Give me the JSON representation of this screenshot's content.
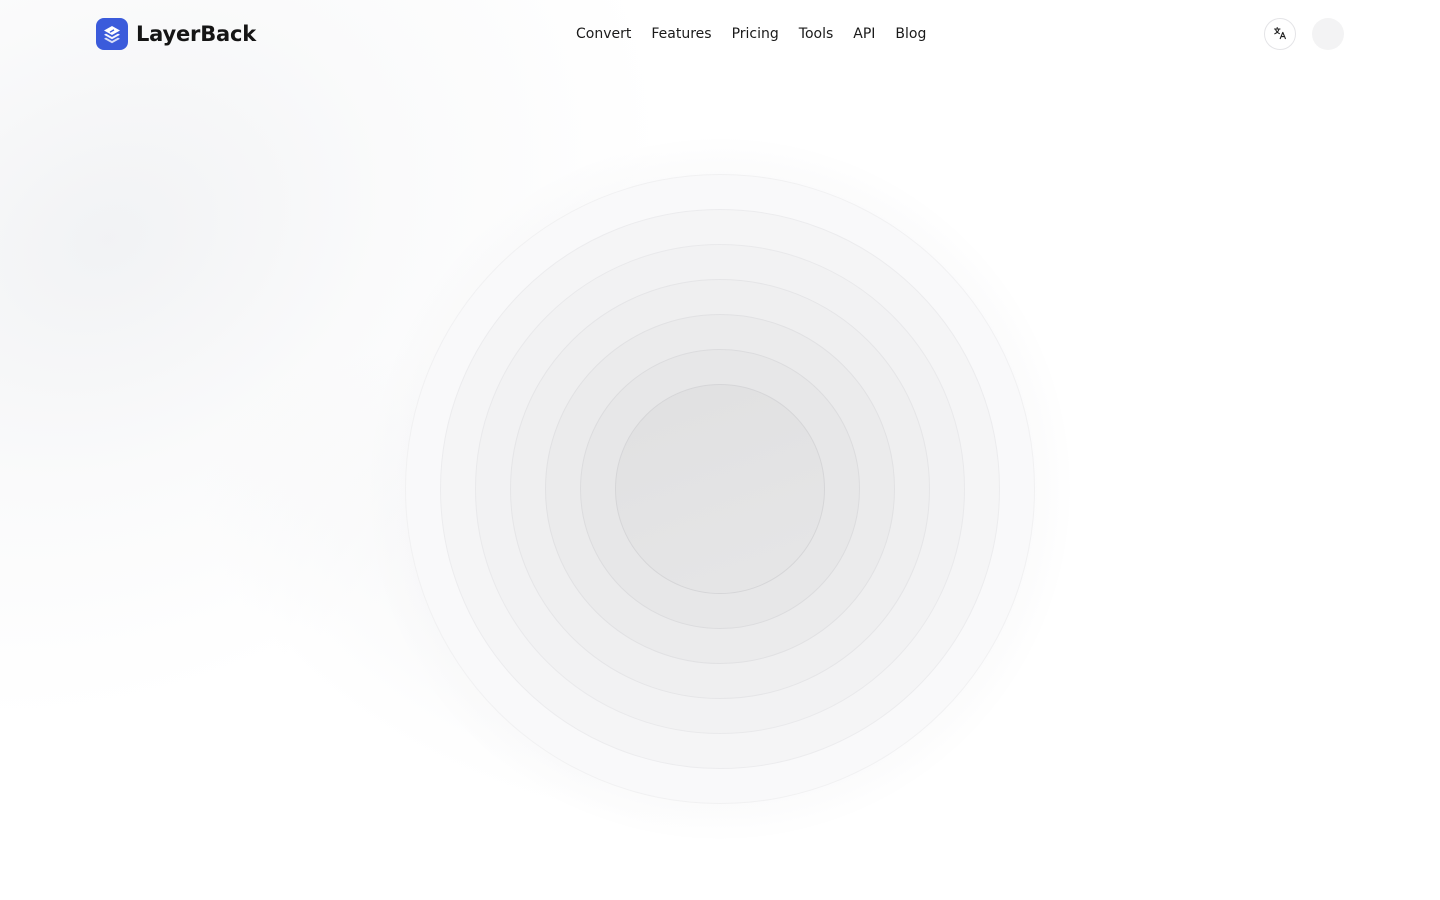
{
  "brand": {
    "name": "LayerBack",
    "logo_color": "#3b5bdb",
    "logo_icon": "layers-icon"
  },
  "nav": {
    "items": [
      {
        "label": "Convert"
      },
      {
        "label": "Features"
      },
      {
        "label": "Pricing"
      },
      {
        "label": "Tools"
      },
      {
        "label": "API"
      },
      {
        "label": "Blog"
      }
    ]
  },
  "header_actions": {
    "language_icon": "translate-icon",
    "avatar": "user-avatar-placeholder"
  },
  "main": {
    "state": "loading",
    "indicator_icon": "concentric-rings-loader"
  }
}
